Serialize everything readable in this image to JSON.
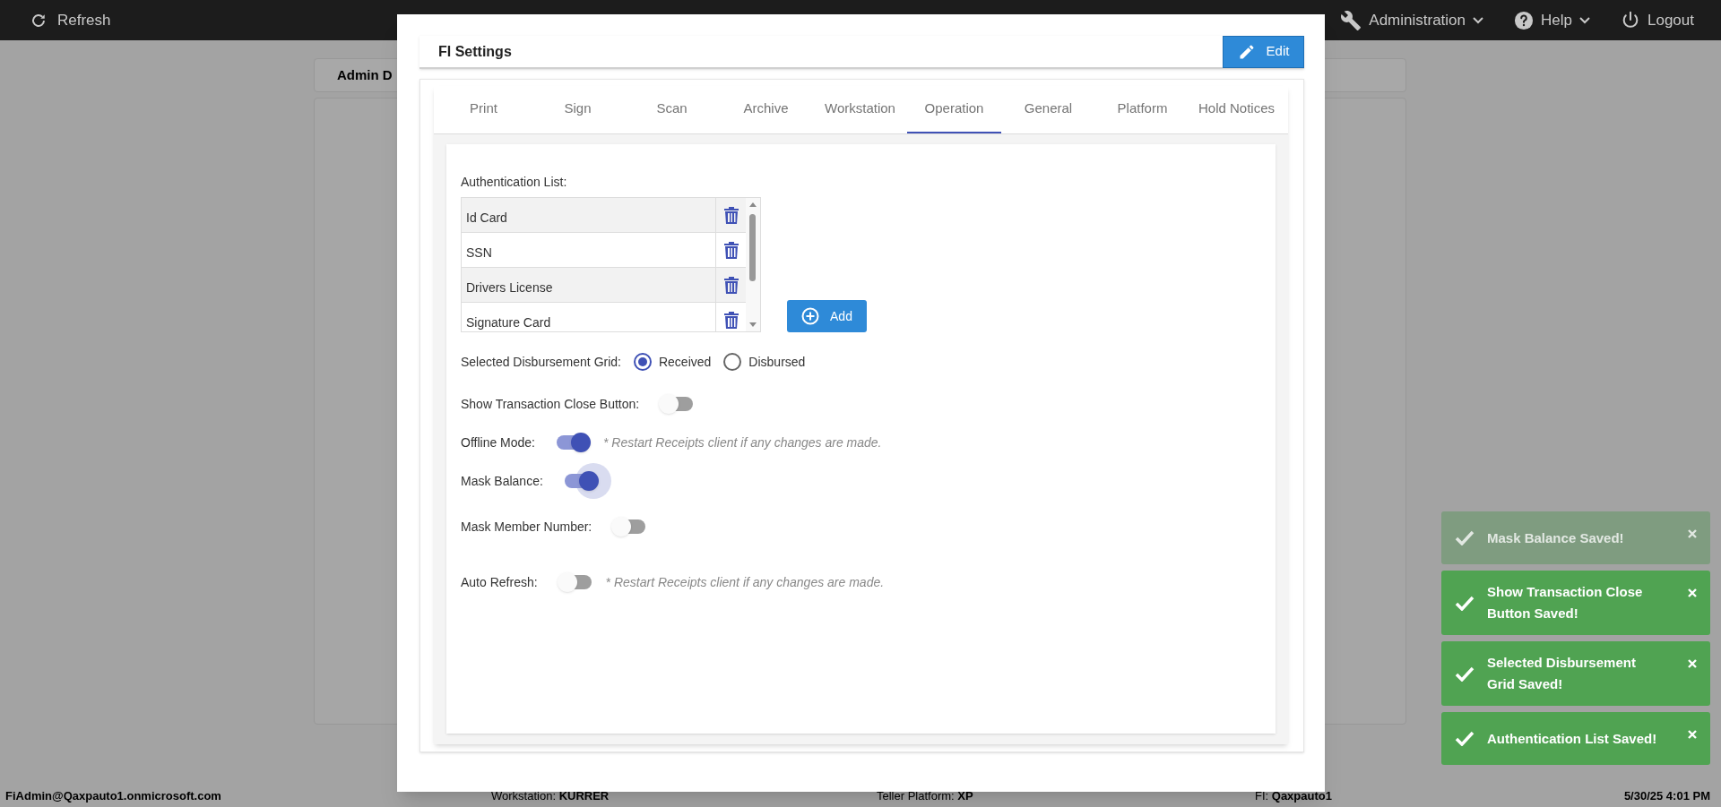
{
  "top_bar": {
    "refresh": "Refresh",
    "menus": [
      {
        "label": "Administration",
        "kind": "dropdown"
      },
      {
        "label": "Help",
        "kind": "dropdown"
      },
      {
        "label": "Logout",
        "kind": "button"
      }
    ]
  },
  "background": {
    "tab": "Admin D"
  },
  "modal": {
    "title": "FI Settings",
    "edit_button": "Edit",
    "tabs": [
      {
        "label": "Print",
        "selected": false
      },
      {
        "label": "Sign",
        "selected": false
      },
      {
        "label": "Scan",
        "selected": false
      },
      {
        "label": "Archive",
        "selected": false
      },
      {
        "label": "Workstation",
        "selected": false
      },
      {
        "label": "Operation",
        "selected": true
      },
      {
        "label": "General",
        "selected": false
      },
      {
        "label": "Platform",
        "selected": false
      },
      {
        "label": "Hold Notices",
        "selected": false
      }
    ],
    "authentication_list": {
      "label": "Authentication List:",
      "items": [
        "Id Card",
        "SSN",
        "Drivers License",
        "Signature Card"
      ],
      "add_button": "Add"
    },
    "settings": [
      {
        "kind": "radio",
        "label": "Selected Disbursement Grid:",
        "options": [
          {
            "label": "Received",
            "selected": true
          },
          {
            "label": "Disbursed",
            "selected": false
          }
        ]
      },
      {
        "kind": "toggle",
        "label": "Show Transaction Close Button:",
        "on": false,
        "focused": false
      },
      {
        "kind": "toggle",
        "label": "Offline Mode:",
        "on": true,
        "focused": false,
        "note": "* Restart Receipts client if any changes are made."
      },
      {
        "kind": "toggle",
        "label": "Mask Balance:",
        "on": true,
        "focused": true
      },
      {
        "kind": "toggle",
        "label": "Mask Member Number:",
        "on": false,
        "focused": false
      },
      {
        "kind": "toggle",
        "label": "Auto Refresh:",
        "on": false,
        "focused": false,
        "note": "* Restart Receipts client if any changes are made."
      }
    ]
  },
  "toasts": [
    {
      "message": "Mask Balance Saved!",
      "faded": true
    },
    {
      "message": "Show Transaction Close Button Saved!",
      "faded": false
    },
    {
      "message": "Selected Disbursement Grid Saved!",
      "faded": false
    },
    {
      "message": "Authentication List Saved!",
      "faded": false
    }
  ],
  "status_bar": {
    "user": "FiAdmin@Qaxpauto1.onmicrosoft.com",
    "workstation_label": "Workstation:",
    "workstation": "KURRER",
    "platform_label": "Teller Platform:",
    "platform": "XP",
    "fi_label": "FI:",
    "fi": "Qaxpauto1",
    "datetime": "5/30/25 4:01 PM"
  }
}
